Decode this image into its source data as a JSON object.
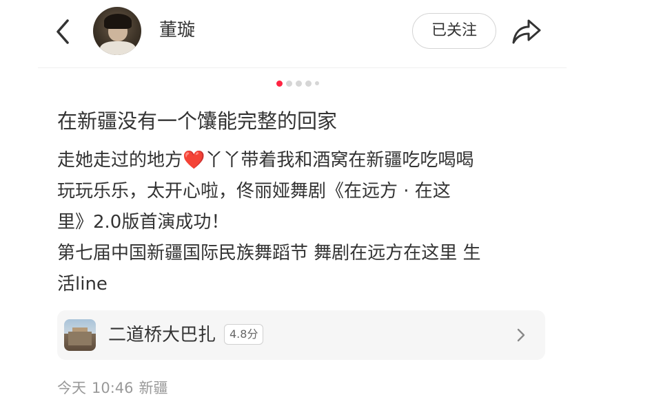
{
  "header": {
    "username": "董璇",
    "follow_label": "已关注",
    "back_icon": "back-arrow-icon",
    "share_icon": "share-icon",
    "accent_color": "#ff2442"
  },
  "carousel": {
    "pages": 5,
    "active_index": 0
  },
  "post": {
    "title": "在新疆没有一个馕能完整的回家",
    "body_lines": [
      {
        "text_a": "走她走过的地方",
        "emoji": "❤️",
        "text_b": "丫丫带着我和酒窝在新疆吃吃喝喝"
      },
      {
        "text": "玩玩乐乐，太开心啦，佟丽娅舞剧《在远方 · 在这"
      },
      {
        "text": "里》2.0版首演成功！"
      },
      {
        "text": "第七届中国新疆国际民族舞蹈节 舞剧在远方在这里 生"
      },
      {
        "text": "活line"
      }
    ]
  },
  "location": {
    "name": "二道桥大巴扎",
    "rating": "4.8分"
  },
  "meta": {
    "day": "今天",
    "time": "10:46",
    "region": "新疆"
  }
}
